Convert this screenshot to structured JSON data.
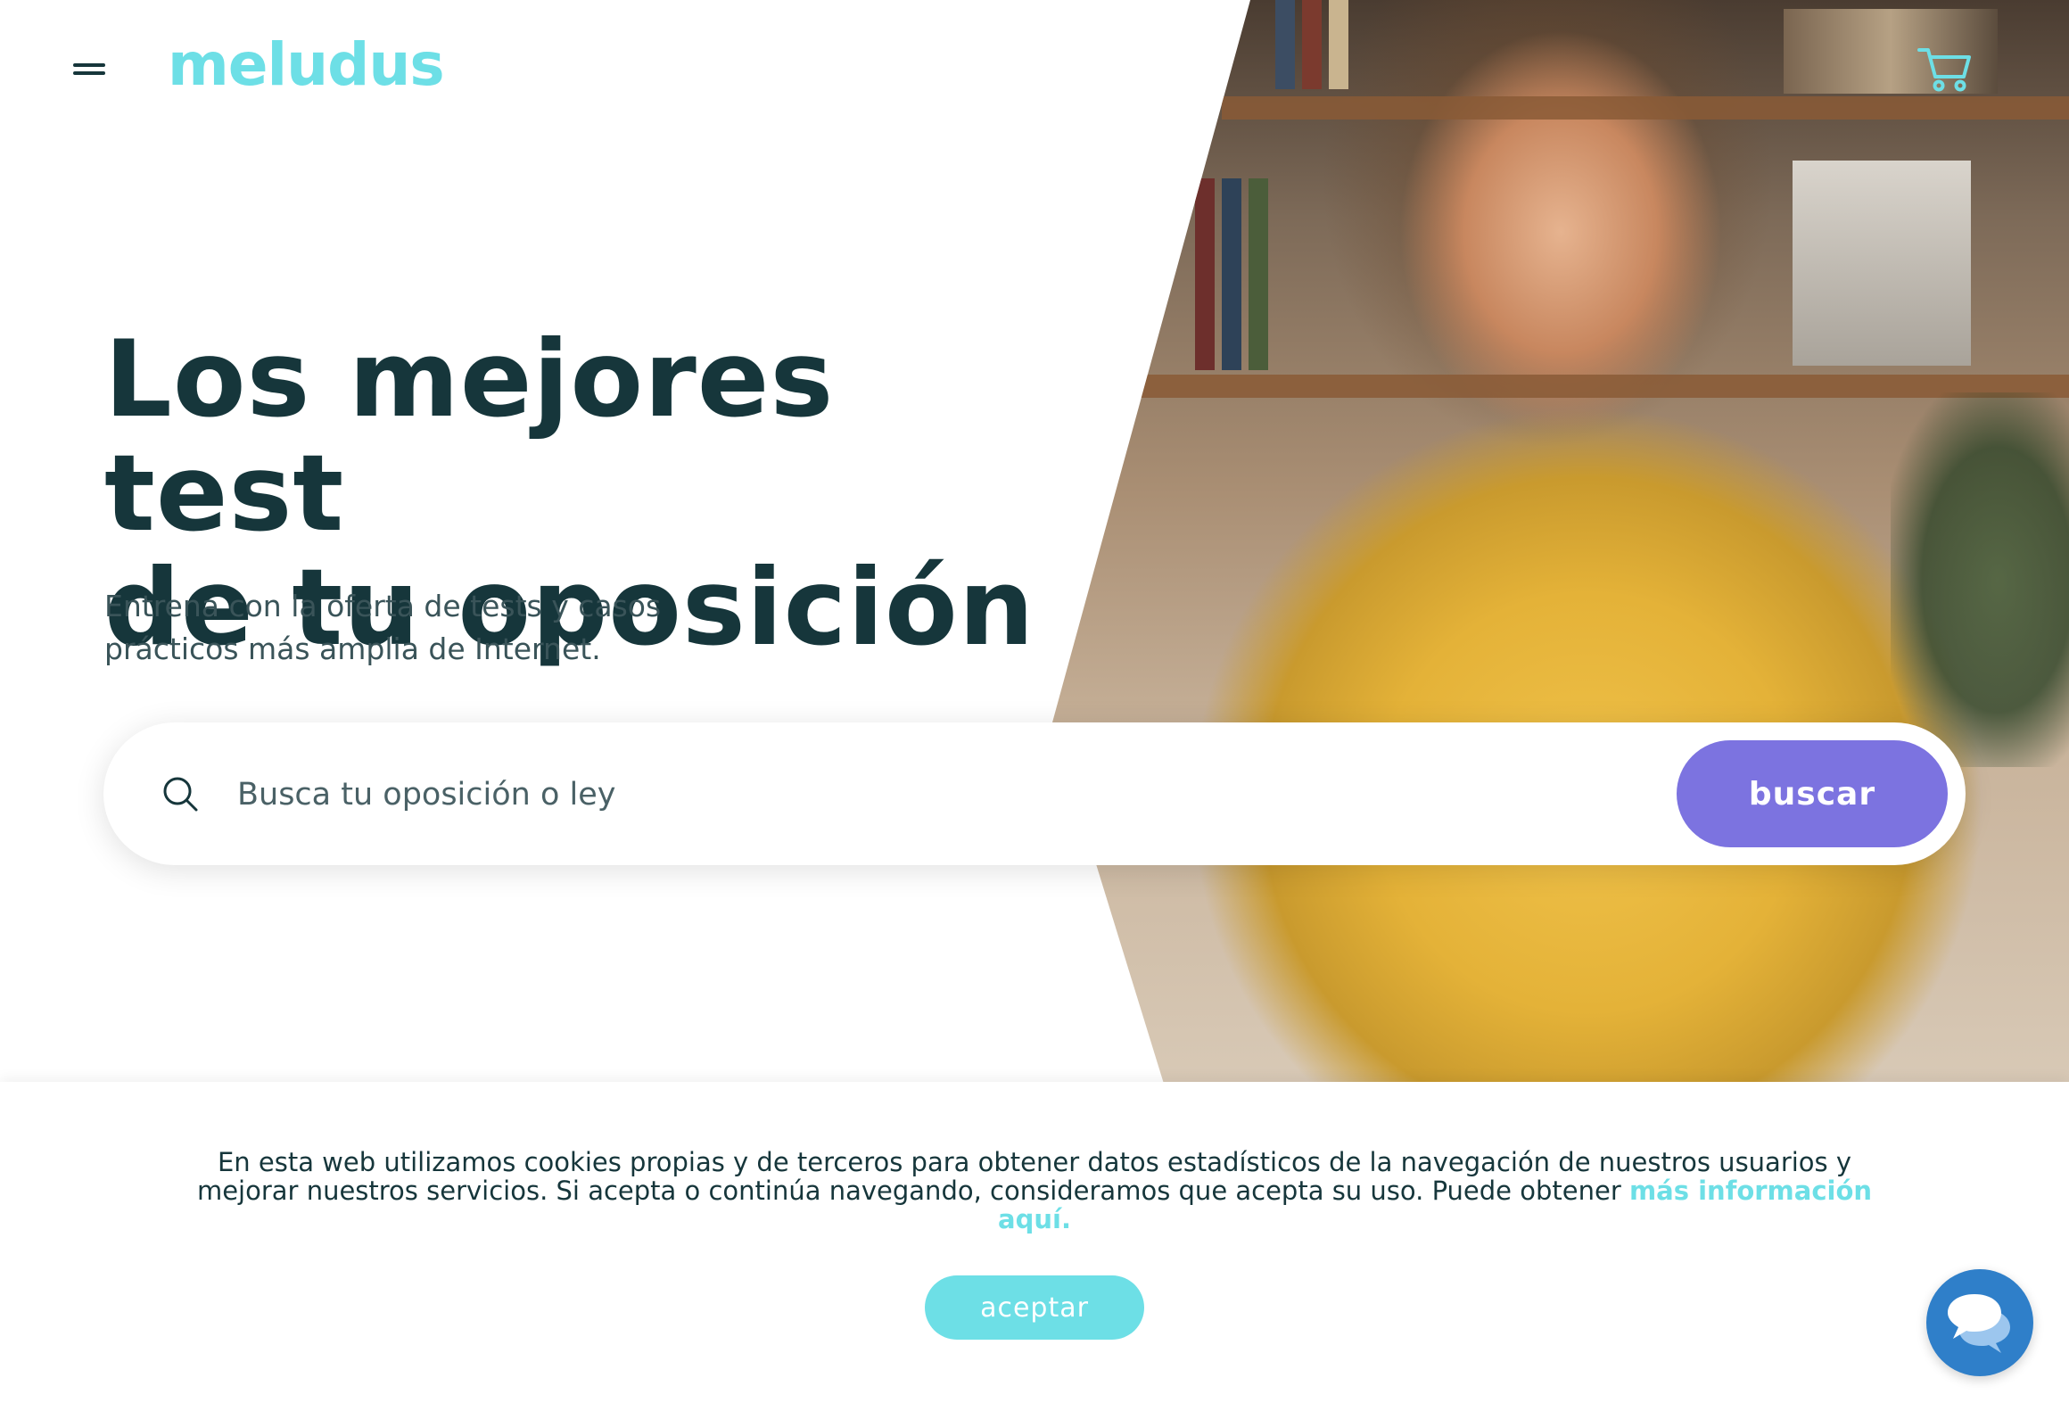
{
  "header": {
    "logo_text": "meludus",
    "menu_icon": "hamburger-menu-icon",
    "cart_icon": "shopping-cart-icon"
  },
  "hero": {
    "headline_line1": "Los mejores test",
    "headline_line2": "de tu oposición",
    "subtitle_line1": "Entrena con la oferta de tests y casos",
    "subtitle_line2": "prácticos más amplia de Internet.",
    "image": "woman-in-yellow-shirt-photo"
  },
  "search": {
    "placeholder": "Busca tu oposición o ley",
    "button_label": "buscar",
    "icon": "search-icon"
  },
  "cookie_banner": {
    "text_line1": "En esta web utilizamos cookies propias y de terceros para obtener datos estadísticos de la navegación de nuestros usuarios y",
    "text_line2": "mejorar nuestros servicios. Si acepta o continúa navegando, consideramos que acepta su uso. Puede obtener",
    "link_label": "más información aquí.",
    "accept_label": "aceptar"
  },
  "chat": {
    "icon": "chat-bubbles-icon"
  },
  "colors": {
    "brand_cyan": "#6ddfe6",
    "button_purple": "#7c73e0",
    "text_dark": "#16363b",
    "chat_blue": "#2f7fc9"
  }
}
